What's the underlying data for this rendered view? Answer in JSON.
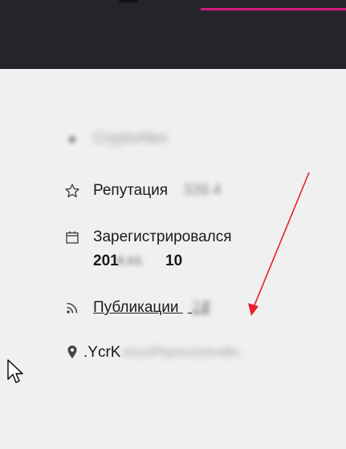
{
  "username": "CryptoAlex",
  "reputation": {
    "label": "Репутация",
    "value": "339.4"
  },
  "registered": {
    "label": "Зарегистрировался",
    "date_prefix": "201",
    "date_hidden": "8.03.",
    "date_suffix": "10"
  },
  "publications": {
    "label": "Публикации",
    "count_visible": "2",
    "count_hidden": "24"
  },
  "location": {
    "prefix": ".YcrK",
    "hidden": "ssLkJPfyjonuGdvntBu"
  },
  "icons": {
    "username": "user-icon",
    "reputation": "star-icon",
    "registered": "calendar-icon",
    "publications": "rss-icon",
    "location": "map-pin-icon"
  },
  "colors": {
    "header_bg": "#23252b",
    "accent": "#d6197f",
    "page_bg": "#f0f0f0",
    "annotation_arrow": "#e8202a"
  }
}
